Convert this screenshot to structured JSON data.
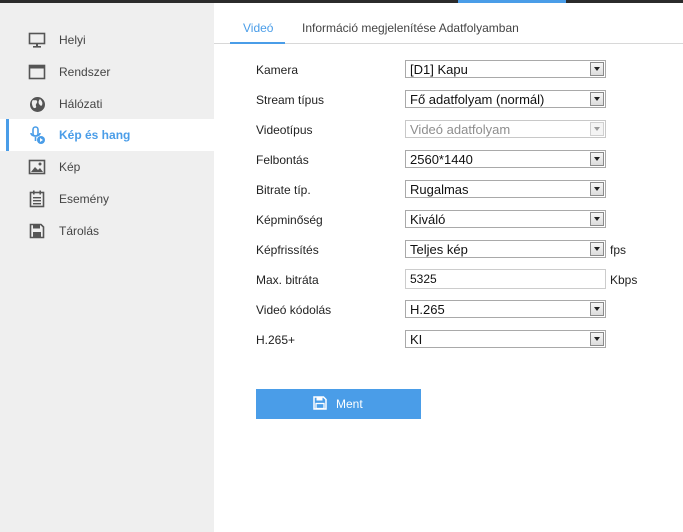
{
  "sidebar": {
    "items": [
      {
        "label": "Helyi",
        "icon": "monitor-icon"
      },
      {
        "label": "Rendszer",
        "icon": "window-icon"
      },
      {
        "label": "Hálózati",
        "icon": "globe-icon"
      },
      {
        "label": "Kép és hang",
        "icon": "microphone-icon",
        "active": true
      },
      {
        "label": "Kép",
        "icon": "image-icon"
      },
      {
        "label": "Esemény",
        "icon": "calendar-icon"
      },
      {
        "label": "Tárolás",
        "icon": "floppy-icon"
      }
    ]
  },
  "tabs": [
    {
      "label": "Videó",
      "active": true
    },
    {
      "label": "Információ megjelenítése Adatfolyamban"
    }
  ],
  "form": {
    "kamera": {
      "label": "Kamera",
      "value": "[D1] Kapu"
    },
    "stream": {
      "label": "Stream típus",
      "value": "Fő adatfolyam (normál)"
    },
    "videotipus": {
      "label": "Videotípus",
      "value": "Videó adatfolyam",
      "disabled": true
    },
    "felbontas": {
      "label": "Felbontás",
      "value": "2560*1440"
    },
    "bitrate_tip": {
      "label": "Bitrate típ.",
      "value": "Rugalmas"
    },
    "kepminoseg": {
      "label": "Képminőség",
      "value": "Kiváló"
    },
    "kepfrissites": {
      "label": "Képfrissítés",
      "value": "Teljes kép",
      "unit": "fps"
    },
    "max_bitrata": {
      "label": "Max. bitráta",
      "value": "5325",
      "unit": "Kbps"
    },
    "video_kodolas": {
      "label": "Videó kódolás",
      "value": "H.265"
    },
    "h265plus": {
      "label": "H.265+",
      "value": "KI"
    }
  },
  "save_button": {
    "label": "Ment",
    "icon": "save-icon"
  },
  "colors": {
    "accent": "#4a9de8",
    "sidebar_bg": "#efefef",
    "topbar": "#2b2b2b"
  }
}
